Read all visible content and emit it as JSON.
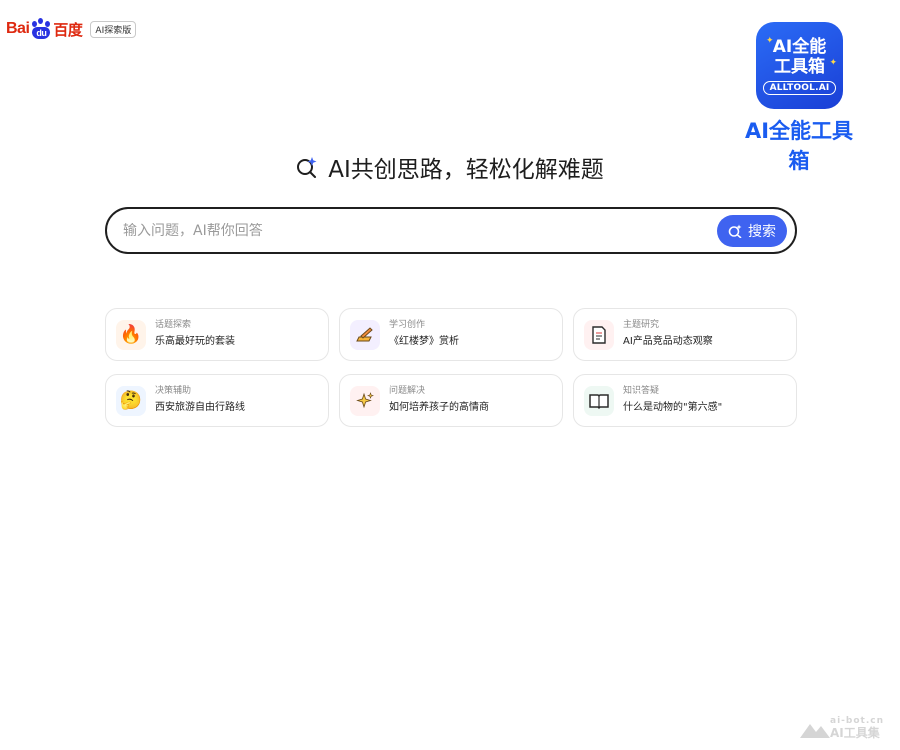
{
  "header": {
    "logo_text_left": "Bai",
    "logo_paw_text": "du",
    "logo_text_right": "百度",
    "logo_tag": "AI探索版"
  },
  "promo_badge": {
    "line1": "AI全能",
    "line2": "工具箱",
    "url": "ALLTOOL.AI",
    "caption": "AI全能工具箱",
    "color": "#1a5cf0"
  },
  "hero": {
    "icon": "sparkle-search-icon",
    "title": "AI共创思路，轻松化解难题"
  },
  "search": {
    "placeholder": "输入问题，AI帮你回答",
    "button_label": "搜索",
    "button_color": "#3f63f0"
  },
  "suggestions": [
    {
      "category": "话题探索",
      "question": "乐高最好玩的套装",
      "icon": "fire-icon",
      "glyph": "🔥",
      "bg": "#fff4ea"
    },
    {
      "category": "学习创作",
      "question": "《红楼梦》赏析",
      "icon": "pen-writing-icon",
      "glyph": "✍",
      "bg": "#f3efff"
    },
    {
      "category": "主题研究",
      "question": "AI产品竞品动态观察",
      "icon": "document-icon",
      "glyph": "📄",
      "bg": "#fff1f1"
    },
    {
      "category": "决策辅助",
      "question": "西安旅游自由行路线",
      "icon": "thinking-face-icon",
      "glyph": "🤔",
      "bg": "#eef5ff"
    },
    {
      "category": "问题解决",
      "question": "如何培养孩子的高情商",
      "icon": "sparkles-icon",
      "glyph": "✨",
      "bg": "#fff1f1"
    },
    {
      "category": "知识答疑",
      "question": "什么是动物的\"第六感\"",
      "icon": "open-book-icon",
      "glyph": "📖",
      "bg": "#eef8f3"
    }
  ],
  "watermark": {
    "url": "ai-bot.cn",
    "name": "AI工具集"
  }
}
